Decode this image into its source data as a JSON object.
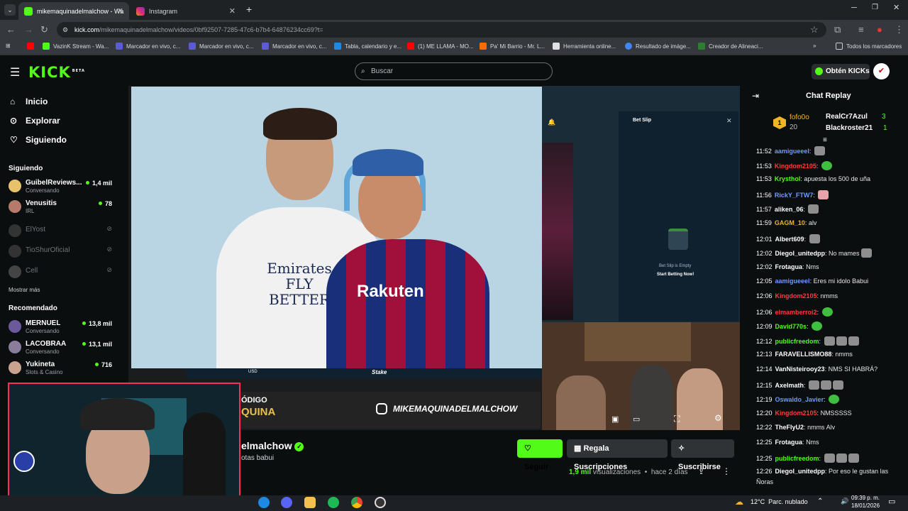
{
  "browser": {
    "tabs": [
      {
        "label": "mikemaquinadelmalchow - Wa",
        "active": true
      },
      {
        "label": "Instagram",
        "active": false
      }
    ],
    "url_host": "kick.com",
    "url_path": "/mikemaquinadelmalchow/videos/0bf92507-7285-47c6-b7b4-64876234cc69?t=",
    "bookmarks": [
      "VazinK Stream - Wa...",
      "Marcador en vivo, c...",
      "Marcador en vivo, c...",
      "Marcador en vivo, c...",
      "Tabla, calendario y e...",
      "(1) ME LLAMA - MO...",
      "Pa' Mi Barrio - Mr. L...",
      "Herramienta online...",
      "Resultado de imáge...",
      "Creador de Alineaci..."
    ],
    "all_bookmarks": "Todos los marcadores"
  },
  "header": {
    "logo": "KICK",
    "logo_badge": "BETA",
    "search_placeholder": "Buscar",
    "kicks_button": "Obtén KICKs"
  },
  "sidebar": {
    "nav": [
      "Inicio",
      "Explorar",
      "Siguiendo"
    ],
    "following_title": "Siguiendo",
    "following": [
      {
        "name": "GuibelReviews...",
        "sub": "Conversando",
        "viewers": "1,4 mil",
        "live": true
      },
      {
        "name": "Venusitis",
        "sub": "IRL",
        "viewers": "78",
        "live": true
      },
      {
        "name": "ElYost",
        "live": false
      },
      {
        "name": "TioShurOficial",
        "live": false
      },
      {
        "name": "Cell",
        "live": false
      }
    ],
    "show_more": "Mostrar más",
    "recommended_title": "Recomendado",
    "recommended": [
      {
        "name": "MERNUEL",
        "sub": "Conversando",
        "viewers": "13,8 mil"
      },
      {
        "name": "LACOBRAA",
        "sub": "Conversando",
        "viewers": "13,1 mil"
      },
      {
        "name": "Yukineta",
        "sub": "Slots & Casino",
        "viewers": "716"
      }
    ]
  },
  "video": {
    "jersey_left": "Emirates FLY BETTER",
    "jersey_right": "Rakuten",
    "betslip_title": "Bet Slip",
    "betslip_empty": "Bet Slip is Empty",
    "betslip_cta": "Start Betting Now!",
    "currency": "USD",
    "stake_logo": "Stake",
    "banner_left": "ÓDIGO",
    "banner_left2": "QUINA",
    "banner_handle": "MIKEMAQUINADELMALCHOW"
  },
  "channel": {
    "name": "elmalchow",
    "subtitle": "otas babui",
    "follow": "Seguir",
    "gift": "Regala Suscripciones",
    "subscribe": "Suscribirse",
    "views": "1,9 mil",
    "views_label": "visualizaciones",
    "age": "hace 2 días"
  },
  "chat": {
    "title": "Chat Replay",
    "top_gifters": [
      {
        "name": "fofo0o",
        "count": "20",
        "rank": "1"
      },
      {
        "name": "RealCr7Azul",
        "count": "3"
      },
      {
        "name": "Blackroster21",
        "count": "1"
      }
    ],
    "messages": [
      {
        "time": "11:52",
        "user": "aamigueeel",
        "color": "#6e9bff",
        "text": "",
        "emotes": 1
      },
      {
        "time": "11:53",
        "user": "Kingdom2105",
        "color": "#ff3b3b",
        "text": "",
        "emotes": 1,
        "green": true
      },
      {
        "time": "11:53",
        "user": "Krysthol",
        "color": "#53fc18",
        "text": "apuesta los 500 de uña",
        "emotes": 0
      },
      {
        "time": "11:56",
        "user": "RickY_FTW7",
        "color": "#6e9bff",
        "text": "",
        "emotes": 1,
        "pink": true
      },
      {
        "time": "11:57",
        "user": "aliken_06",
        "color": "#ffffff",
        "text": "",
        "emotes": 1
      },
      {
        "time": "11:59",
        "user": "GAGM_10",
        "color": "#f0b429",
        "text": "alv",
        "emotes": 0
      },
      {
        "time": "12:01",
        "user": "Albert609",
        "color": "#ffffff",
        "text": "",
        "emotes": 1
      },
      {
        "time": "12:02",
        "user": "Diegol_unitedpp",
        "color": "#ffffff",
        "text": "No mames",
        "emotes": 1
      },
      {
        "time": "12:02",
        "user": "Frotagua",
        "color": "#ffffff",
        "text": "Nms",
        "emotes": 0
      },
      {
        "time": "12:05",
        "user": "aamigueeel",
        "color": "#6e9bff",
        "text": "Eres mi idolo Babui",
        "emotes": 0
      },
      {
        "time": "12:06",
        "user": "Kingdom2105",
        "color": "#ff3b3b",
        "text": "nmms",
        "emotes": 0
      },
      {
        "time": "12:06",
        "user": "elmamberroi2",
        "color": "#ff3b3b",
        "text": "",
        "emotes": 1,
        "green": true
      },
      {
        "time": "12:09",
        "user": "David770s",
        "color": "#53fc18",
        "text": "",
        "emotes": 1,
        "green": true
      },
      {
        "time": "12:12",
        "user": "publicfreedom",
        "color": "#53fc18",
        "text": "",
        "emotes": 3
      },
      {
        "time": "12:13",
        "user": "FARAVELLISMO88",
        "color": "#ffffff",
        "text": "nmms",
        "emotes": 0
      },
      {
        "time": "12:14",
        "user": "VanNisteirooy23",
        "color": "#ffffff",
        "text": "NMS SI HABRÁ?",
        "emotes": 0
      },
      {
        "time": "12:15",
        "user": "Axelmath",
        "color": "#ffffff",
        "text": "",
        "emotes": 3
      },
      {
        "time": "12:19",
        "user": "Oswaldo_Javier",
        "color": "#6e9bff",
        "text": "",
        "emotes": 1,
        "green": true
      },
      {
        "time": "12:20",
        "user": "Kingdom2105",
        "color": "#ff3b3b",
        "text": "NMSSSSS",
        "emotes": 0
      },
      {
        "time": "12:22",
        "user": "TheFlyU2",
        "color": "#ffffff",
        "text": "nmms Alv",
        "emotes": 0
      },
      {
        "time": "12:25",
        "user": "Frotagua",
        "color": "#ffffff",
        "text": "Nms",
        "emotes": 0
      },
      {
        "time": "12:25",
        "user": "publicfreedom",
        "color": "#53fc18",
        "text": "",
        "emotes": 3
      },
      {
        "time": "12:26",
        "user": "Diegol_unitedpp",
        "color": "#ffffff",
        "text": "Por eso le gustan las",
        "emotes": 0
      }
    ],
    "last_line_cont": "Ñoras"
  },
  "taskbar": {
    "temp": "12°C",
    "weather": "Parc. nublado",
    "time": "09:39 p. m.",
    "date": "18/01/2026"
  },
  "colors": {
    "kick_green": "#53fc18",
    "bg": "#0b0e0f",
    "webcam_border": "#ff2d55"
  }
}
